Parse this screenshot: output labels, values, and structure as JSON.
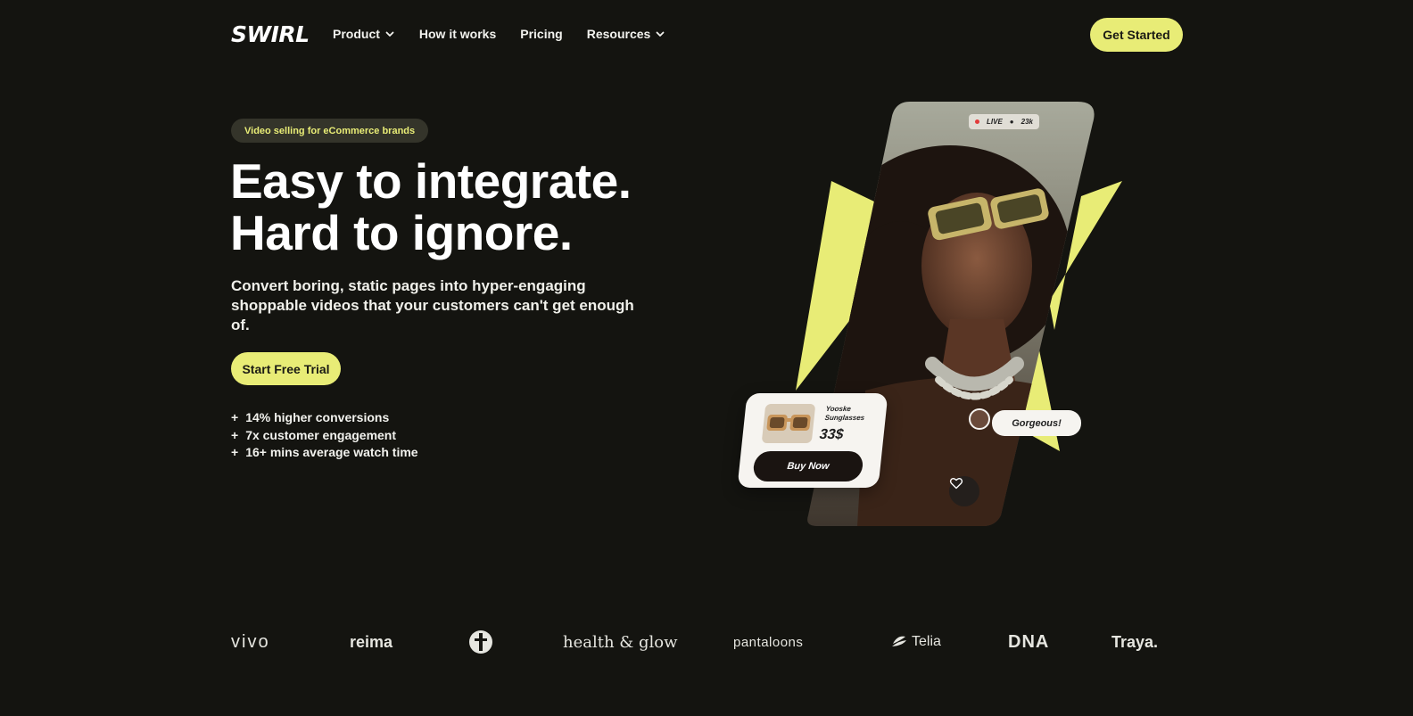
{
  "brand": {
    "logo": "SWIRL"
  },
  "nav": {
    "items": [
      {
        "label": "Product",
        "has_dropdown": true
      },
      {
        "label": "How it works",
        "has_dropdown": false
      },
      {
        "label": "Pricing",
        "has_dropdown": false
      },
      {
        "label": "Resources",
        "has_dropdown": true
      }
    ],
    "cta": "Get Started"
  },
  "hero": {
    "pill": "Video selling for eCommerce brands",
    "headline_line1": "Easy to integrate.",
    "headline_line2": "Hard to ignore.",
    "subtitle": "Convert boring, static pages into hyper-engaging shoppable videos that your customers can't get enough of.",
    "cta": "Start Free Trial",
    "stats": [
      {
        "prefix": "+",
        "text": "14% higher conversions"
      },
      {
        "prefix": "+",
        "text": "7x customer engagement"
      },
      {
        "prefix": "+",
        "text": "16+ mins average watch time"
      }
    ]
  },
  "video_card": {
    "live_label": "LIVE",
    "viewer_count": "23k",
    "product_name": "Yooske Sunglasses",
    "price": "33$",
    "buy_label": "Buy Now",
    "comment": "Gorgeous!"
  },
  "logos": [
    "vivo",
    "reima",
    "health & glow",
    "pantaloons",
    "Telia",
    "DNA",
    "Traya."
  ],
  "colors": {
    "background": "#141410",
    "accent": "#e8ec76",
    "pill_bg": "#34342a"
  }
}
